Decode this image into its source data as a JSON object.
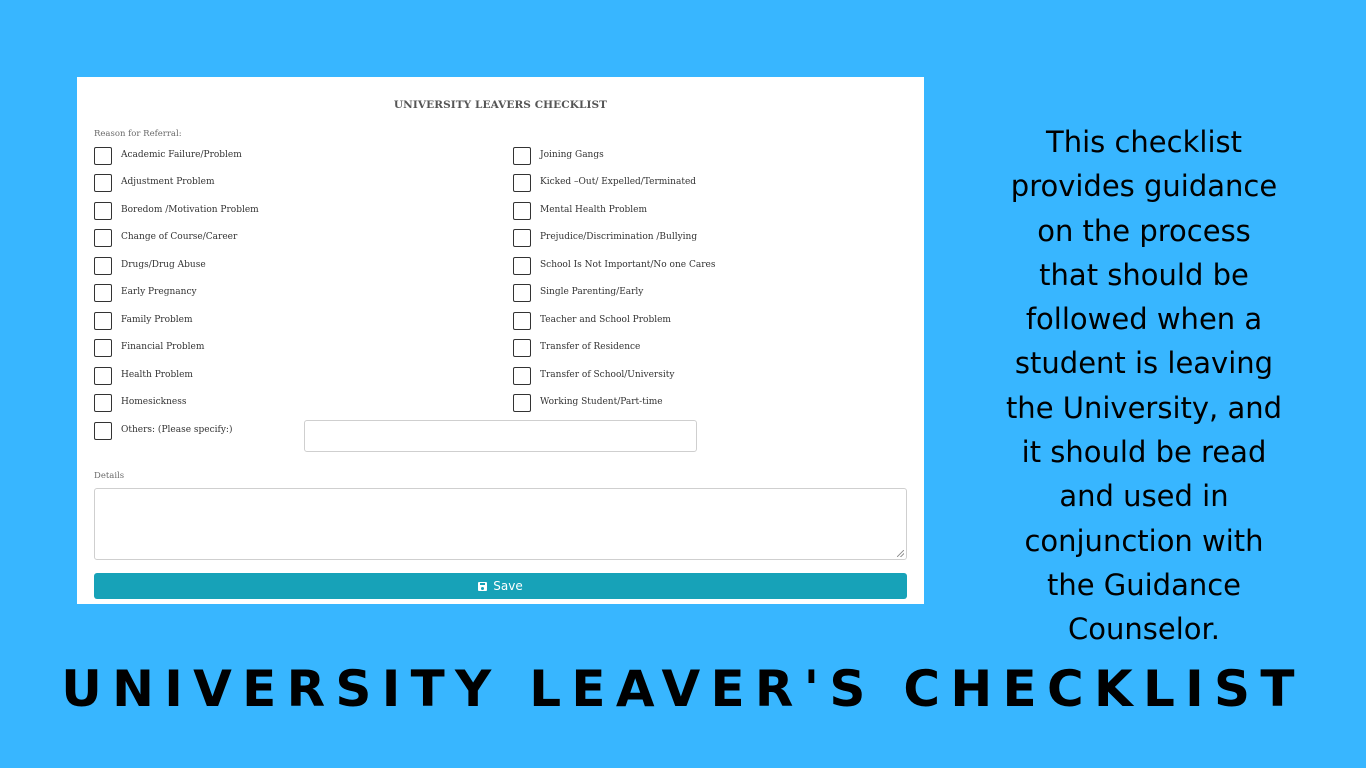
{
  "form": {
    "title": "UNIVERSITY LEAVERS CHECKLIST",
    "reason_label": "Reason for Referral:",
    "left_options": [
      {
        "label": "Academic Failure/Problem",
        "checked": false
      },
      {
        "label": "Adjustment Problem",
        "checked": false
      },
      {
        "label": "Boredom /Motivation Problem",
        "checked": false
      },
      {
        "label": "Change of Course/Career",
        "checked": false
      },
      {
        "label": "Drugs/Drug Abuse",
        "checked": false
      },
      {
        "label": "Early Pregnancy",
        "checked": false
      },
      {
        "label": "Family Problem",
        "checked": false
      },
      {
        "label": "Financial Problem",
        "checked": false
      },
      {
        "label": "Health Problem",
        "checked": false
      },
      {
        "label": "Homesickness",
        "checked": false
      },
      {
        "label": "Others: (Please specify:)",
        "checked": false
      }
    ],
    "right_options": [
      {
        "label": "Joining Gangs",
        "checked": false
      },
      {
        "label": "Kicked –Out/ Expelled/Terminated",
        "checked": false
      },
      {
        "label": "Mental Health Problem",
        "checked": false
      },
      {
        "label": "Prejudice/Discrimination /Bullying",
        "checked": false
      },
      {
        "label": "School Is Not Important/No one Cares",
        "checked": false
      },
      {
        "label": "Single Parenting/Early",
        "checked": false
      },
      {
        "label": "Teacher and School Problem",
        "checked": false
      },
      {
        "label": "Transfer of Residence",
        "checked": false
      },
      {
        "label": "Transfer of School/University",
        "checked": false
      },
      {
        "label": "Working Student/Part-time",
        "checked": false
      }
    ],
    "others_value": "",
    "details_label": "Details",
    "details_value": "",
    "save_label": "Save",
    "save_icon": "floppy-disk-icon",
    "accent_color": "#17a2b8"
  },
  "side_text": {
    "lines": [
      "This checklist",
      "provides guidance",
      "on the process",
      "that should be",
      "followed when a",
      "student is leaving",
      "the University, and",
      "it should be read",
      "and used in",
      "conjunction with",
      "the Guidance",
      "Counselor."
    ]
  },
  "banner": {
    "title": "UNIVERSITY LEAVER'S CHECKLIST"
  },
  "colors": {
    "background": "#38b6ff",
    "card": "#ffffff"
  }
}
